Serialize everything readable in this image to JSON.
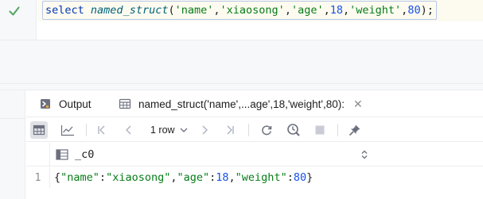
{
  "editor": {
    "code": {
      "keyword": "select",
      "function": "named_struct",
      "open": "(",
      "arg1": "'name'",
      "arg2": "'xiaosong'",
      "arg3": "'age'",
      "arg4": "18",
      "arg5": "'weight'",
      "arg6": "80",
      "close": ");",
      "comma": ","
    },
    "status_icon": "check-icon",
    "status_color": "#59a869"
  },
  "tabs": [
    {
      "label": "Output",
      "icon": "output-icon"
    },
    {
      "label": "named_struct('name',...age',18,'weight',80):",
      "icon": "table-icon",
      "close": "✕"
    }
  ],
  "toolbar": {
    "rows_label": "1 row",
    "items": [
      "table-view-icon",
      "chart-view-icon",
      "first-page-icon",
      "previous-page-icon",
      "rows-dropdown",
      "next-page-icon",
      "last-page-icon",
      "reload-icon",
      "history-icon",
      "stop-icon",
      "pin-icon"
    ]
  },
  "grid": {
    "column": "_c0",
    "rows": [
      {
        "num": "1",
        "cell": {
          "o": "{",
          "k1": "\"name\"",
          "c1": ":",
          "v1": "\"xiaosong\"",
          "s1": ",",
          "k2": "\"age\"",
          "c2": ":",
          "v2": "18",
          "s2": ",",
          "k3": "\"weight\"",
          "c3": ":",
          "v3": "80",
          "e": "}"
        }
      }
    ]
  },
  "colors": {
    "keyword": "#0033b3",
    "function": "#00627a",
    "string": "#067d17",
    "number": "#1750eb"
  }
}
